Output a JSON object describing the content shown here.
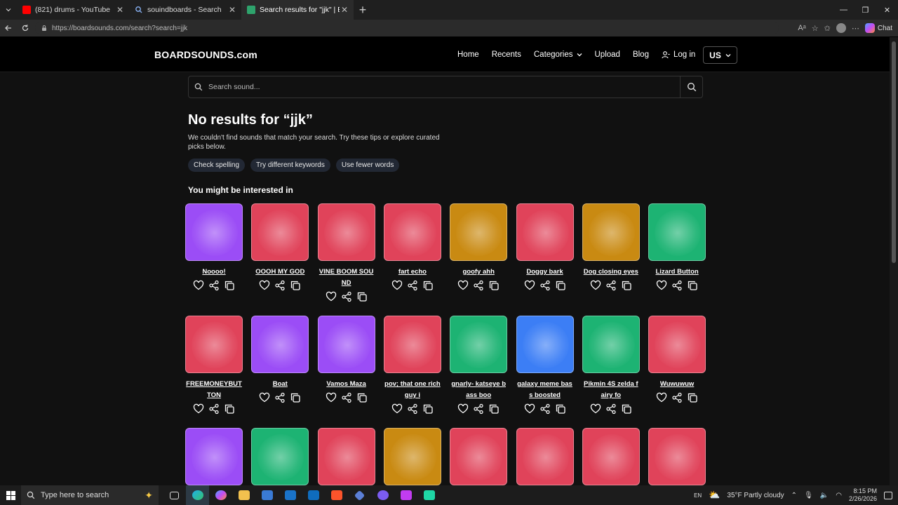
{
  "browser": {
    "tabs": [
      {
        "title": "(821) drums - YouTube",
        "favicon_color": "#ff0000",
        "active": false
      },
      {
        "title": "souindboards - Search",
        "favicon_color": "#4a8fe7",
        "active": false
      },
      {
        "title": "Search results for \"jjk\" | BoardSounds",
        "favicon_color": "#2ea36c",
        "active": true
      }
    ],
    "url": "https://boardsounds.com/search?search=jjk",
    "chat_label": "Chat"
  },
  "site": {
    "logo": "BOARDSOUNDS.com",
    "nav": {
      "home": "Home",
      "recents": "Recents",
      "categories": "Categories",
      "upload": "Upload",
      "blog": "Blog",
      "login": "Log in"
    },
    "region": "US",
    "search_placeholder": "Search sound..."
  },
  "results": {
    "heading": "No results for “jjk”",
    "description": "We couldn't find sounds that match your search. Try these tips or explore curated picks below.",
    "chips": [
      "Check spelling",
      "Try different keywords",
      "Use fewer words"
    ],
    "suggest_heading": "You might be interested in"
  },
  "sounds": [
    {
      "name": "Noooo!",
      "color": "purple"
    },
    {
      "name": "OOOH MY GOD",
      "color": "red"
    },
    {
      "name": "VINE BOOM SOUND",
      "color": "red"
    },
    {
      "name": "fart echo",
      "color": "red"
    },
    {
      "name": "goofy ahh",
      "color": "gold"
    },
    {
      "name": "Doggy bark",
      "color": "red"
    },
    {
      "name": "Dog closing eyes",
      "color": "gold"
    },
    {
      "name": "Lizard Button",
      "color": "green"
    },
    {
      "name": "FREEMONEYBUTTON",
      "color": "red"
    },
    {
      "name": "Boat",
      "color": "purple"
    },
    {
      "name": "Vamos Maza",
      "color": "purple"
    },
    {
      "name": "pov; that one rich guy i",
      "color": "red"
    },
    {
      "name": "gnarly- katseye bass boo",
      "color": "green"
    },
    {
      "name": "galaxy meme bass boosted",
      "color": "blue"
    },
    {
      "name": "Pikmin 4S zelda fairy fo",
      "color": "green"
    },
    {
      "name": "Wuwuwuw",
      "color": "red"
    },
    {
      "name": "",
      "color": "purple"
    },
    {
      "name": "",
      "color": "green"
    },
    {
      "name": "",
      "color": "red"
    },
    {
      "name": "",
      "color": "gold"
    },
    {
      "name": "",
      "color": "red"
    },
    {
      "name": "",
      "color": "red"
    },
    {
      "name": "",
      "color": "red"
    },
    {
      "name": "",
      "color": "red"
    }
  ],
  "taskbar": {
    "search_placeholder": "Type here to search",
    "weather": "35°F  Partly cloudy",
    "lang": "EN",
    "time": "8:15 PM",
    "date": "2/26/2026"
  }
}
